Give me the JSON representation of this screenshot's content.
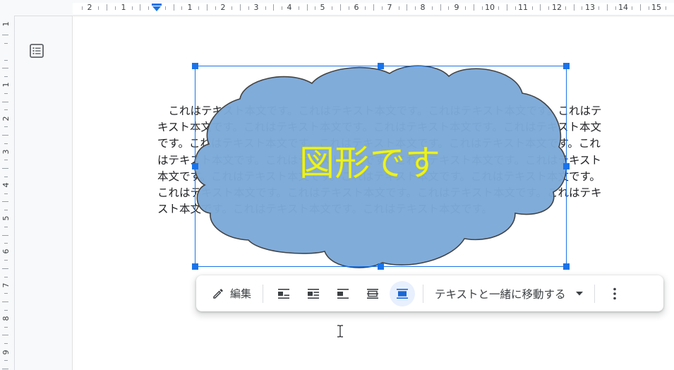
{
  "top_ruler": {
    "labels": [
      "2",
      "1",
      "1",
      "2",
      "3",
      "4",
      "5",
      "6",
      "7",
      "8",
      "9",
      "10",
      "11",
      "12",
      "13",
      "14",
      "15"
    ]
  },
  "left_ruler": {
    "labels": [
      "1",
      "1",
      "2",
      "3",
      "4",
      "5",
      "6",
      "7",
      "8",
      "9"
    ]
  },
  "document": {
    "lines": [
      "　これはテキスト本文です。これはテキスト本文です。これはテキスト本文です。これはテ",
      "キスト本文です。これはテキスト本文です。これはテキスト本文です。これはテキスト本文",
      "です。これはテキスト本文です。これはテキスト本文です。これはテキスト本文です。これ",
      "はテキスト本文です。これはテキスト本文です。これはテキスト本文です。これはテキスト",
      "本文です。これはテキスト本文です。これはテキスト本文です。これはテキスト本文です。",
      "これはテキスト本文です。これはテキスト本文です。これはテキスト本文です。これはテキ",
      "スト本文です。これはテキスト本文です。これはテキスト本文です。"
    ]
  },
  "shape": {
    "text": "図形です",
    "fill_color": "#7ca9d9",
    "stroke_color": "#434343",
    "text_color": "#ffff00",
    "selection_color": "#1a73e8"
  },
  "toolbar": {
    "edit_label": "編集",
    "position_label": "テキストと一緒に移動する",
    "wrap_options": [
      {
        "icon": "inline-text-icon",
        "active": false
      },
      {
        "icon": "wrap-text-icon",
        "active": false
      },
      {
        "icon": "break-text-icon",
        "active": false
      },
      {
        "icon": "behind-text-icon",
        "active": false
      },
      {
        "icon": "in-front-of-text-icon",
        "active": true
      }
    ]
  }
}
